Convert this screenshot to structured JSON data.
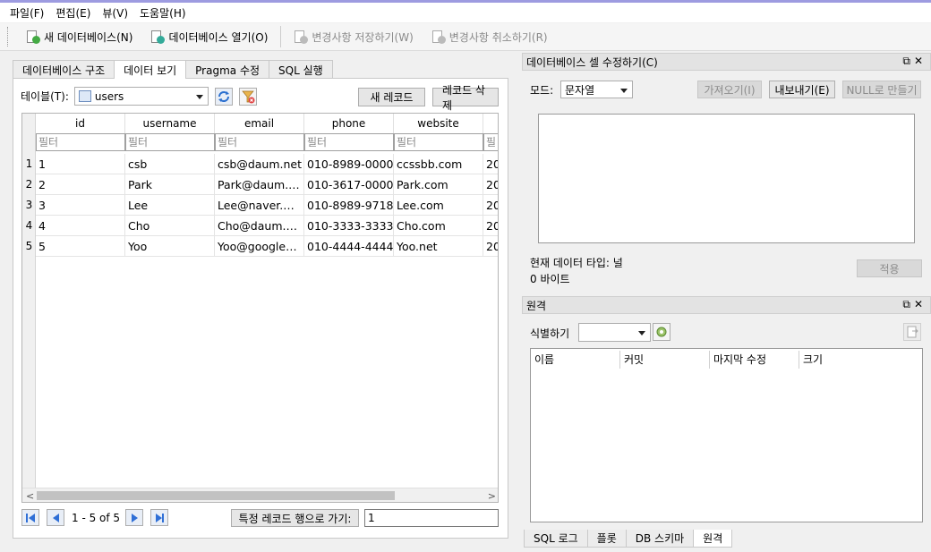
{
  "menu": [
    "파일(F)",
    "편집(E)",
    "뷰(V)",
    "도움말(H)"
  ],
  "toolbar": {
    "new_db": "새 데이터베이스(N)",
    "open_db": "데이터베이스 열기(O)",
    "save_changes": "변경사항 저장하기(W)",
    "revert_changes": "변경사항 취소하기(R)"
  },
  "left_tabs": [
    "데이터베이스 구조",
    "데이터 보기",
    "Pragma 수정",
    "SQL 실행"
  ],
  "browse": {
    "table_label": "테이블(T):",
    "table_value": "users",
    "new_record": "새 레코드",
    "delete_record": "레코드 삭제",
    "columns": [
      "id",
      "username",
      "email",
      "phone",
      "website"
    ],
    "filter_placeholder": "필터",
    "rows": [
      {
        "num": "1",
        "cells": [
          "1",
          "csb",
          "csb@daum.net",
          "010-8989-0000",
          "ccssbb.com",
          "20"
        ]
      },
      {
        "num": "2",
        "cells": [
          "2",
          "Park",
          "Park@daum.…",
          "010-3617-0000",
          "Park.com",
          "20"
        ]
      },
      {
        "num": "3",
        "cells": [
          "3",
          "Lee",
          "Lee@naver.…",
          "010-8989-9718",
          "Lee.com",
          "20"
        ]
      },
      {
        "num": "4",
        "cells": [
          "4",
          "Cho",
          "Cho@daum.…",
          "010-3333-3333",
          "Cho.com",
          "20"
        ]
      },
      {
        "num": "5",
        "cells": [
          "5",
          "Yoo",
          "Yoo@google…",
          "010-4444-4444",
          "Yoo.net",
          "20"
        ]
      }
    ],
    "record_count": "1 - 5 of 5",
    "goto_label": "특정 레코드 행으로 가기:",
    "goto_value": "1"
  },
  "edit_cell": {
    "title": "데이터베이스 셀 수정하기(C)",
    "mode_label": "모드:",
    "mode_value": "문자열",
    "import": "가져오기(I)",
    "export": "내보내기(E)",
    "set_null": "NULL로 만들기",
    "type_info": "현재 데이터 타입: 널",
    "size_info": "0 바이트",
    "apply": "적용"
  },
  "remote": {
    "title": "원격",
    "identity_label": "식별하기",
    "columns": [
      "이름",
      "커밋",
      "마지막 수정",
      "크기"
    ]
  },
  "bottom_tabs": [
    "SQL 로그",
    "플롯",
    "DB 스키마",
    "원격"
  ]
}
